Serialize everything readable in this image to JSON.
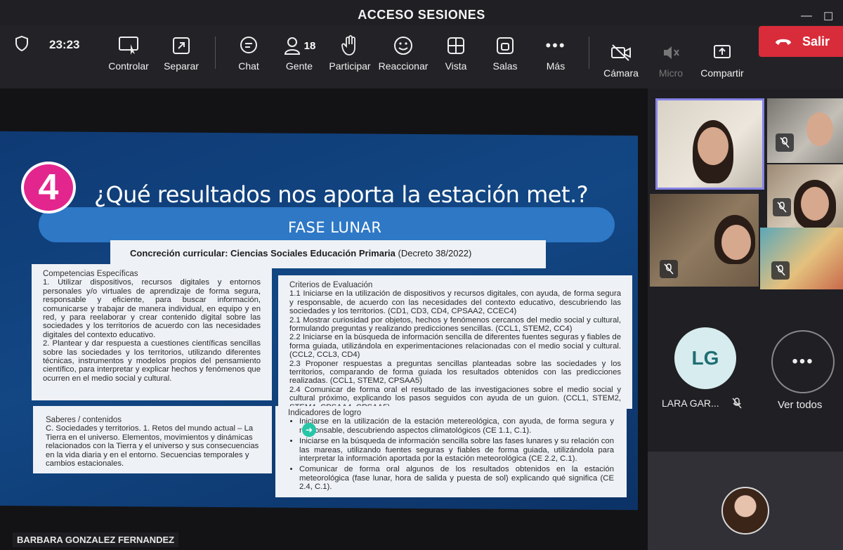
{
  "window": {
    "title": "ACCESO SESIONES"
  },
  "toolbar": {
    "time": "23:23",
    "controlar": "Controlar",
    "separar": "Separar",
    "chat": "Chat",
    "gente": "Gente",
    "gente_count": "18",
    "participar": "Participar",
    "reaccionar": "Reaccionar",
    "vista": "Vista",
    "salas": "Salas",
    "mas": "Más",
    "camara": "Cámara",
    "micro": "Micro",
    "compartir": "Compartir",
    "salir": "Salir"
  },
  "slide": {
    "number": "4",
    "title": "¿Qué resultados nos aporta la estación met.?",
    "subtitle": "FASE LUNAR",
    "curriculum_bold": "Concreción curricular: Ciencias Sociales Educación Primaria",
    "curriculum_note": "(Decreto 38/2022)",
    "competencias": {
      "heading": "Competencias Específicas",
      "item1": "1. Utilizar dispositivos, recursos digitales y entornos personales y/o virtuales de aprendizaje de forma segura, responsable y eficiente, para buscar información, comunicarse y trabajar de manera individual, en equipo y en red, y para reelaborar y crear contenido digital sobre las sociedades y los territorios de acuerdo con las necesidades digitales del contexto educativo.",
      "item2": "2. Plantear y dar respuesta a cuestiones científicas sencillas sobre las sociedades y los territorios, utilizando diferentes técnicas, instrumentos y modelos propios del pensamiento científico, para interpretar y explicar hechos y fenómenos que ocurren en el medio social y cultural."
    },
    "criterios": {
      "heading": "Criterios de Evaluación",
      "c11": "1.1 Iniciarse en la utilización de dispositivos y recursos digitales, con ayuda, de forma segura y responsable, de acuerdo con las necesidades del contexto educativo, descubriendo las sociedades y los territorios. (CD1, CD3, CD4, CPSAA2, CCEC4)",
      "c21": "2.1 Mostrar curiosidad por objetos, hechos y fenómenos cercanos del medio social y cultural, formulando preguntas y realizando predicciones sencillas. (CCL1, STEM2, CC4)",
      "c22": "2.2 Iniciarse en la búsqueda de información sencilla de diferentes fuentes seguras y fiables de forma guiada, utilizándola en experimentaciones relacionadas con el medio social y cultural. (CCL2, CCL3, CD4)",
      "c23": "2.3 Proponer respuestas a preguntas sencillas planteadas sobre las sociedades y los territorios, comparando de forma guiada los resultados obtenidos con las predicciones realizadas. (CCL1, STEM2, CPSAA5)",
      "c24": "2.4 Comunicar de forma oral el resultado de las investigaciones sobre el medio social y cultural próximo, explicando los pasos seguidos con ayuda de un guion. (CCL1, STEM2, STEM4, CPSAA4, CPSAA5)"
    },
    "saberes": {
      "heading": "Saberes / contenidos",
      "body": "C. Sociedades y territorios. 1. Retos del mundo actual – La Tierra en el universo. Elementos, movimientos y dinámicas relacionados con la Tierra y el universo y sus consecuencias en la vida diaria y en el entorno. Secuencias temporales y cambios estacionales."
    },
    "indicadores": {
      "heading": "Indicadores de logro",
      "i1": "Iniciarse en la utilización de la estación metereológica, con ayuda, de forma segura y responsable, descubriendo aspectos climatológicos (CE 1.1, C.1).",
      "i2": "Iniciarse en la búsqueda de información sencilla sobre las fases lunares y su relación con las mareas, utilizando fuentes seguras y fiables de forma guiada, utilizándola para interpretar la información aportada por la estación meteorológica (CE 2.2, C.1).",
      "i3": "Comunicar de forma oral algunos de los resultados obtenidos en la estación meteorológica (fase lunar, hora de salida y puesta de sol) explicando qué significa (CE 2.4, C.1)."
    }
  },
  "presenter": {
    "name": "BARBARA GONZALEZ FERNANDEZ"
  },
  "participants": {
    "lg_initials": "LG",
    "lg_name": "LARA GAR...",
    "see_all": "Ver todos",
    "more": "•••"
  },
  "colors": {
    "accent_purple": "#8583e6",
    "leave_red": "#d92c3a",
    "slide_blue": "#124784",
    "badge_pink": "#e3268d"
  }
}
